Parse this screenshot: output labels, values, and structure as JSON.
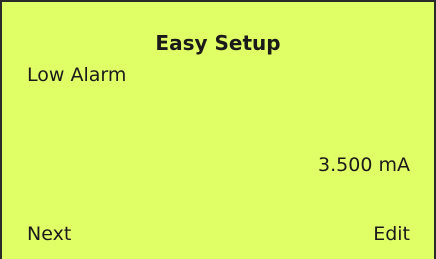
{
  "screen": {
    "title": "Easy Setup",
    "parameter_label": "Low Alarm",
    "value": "3.500 mA"
  },
  "softkeys": {
    "left_label": "Next",
    "right_label": "Edit"
  },
  "colors": {
    "lcd_background": "#e0ff66",
    "text": "#1a1a1a",
    "border": "#2a2a2a"
  }
}
